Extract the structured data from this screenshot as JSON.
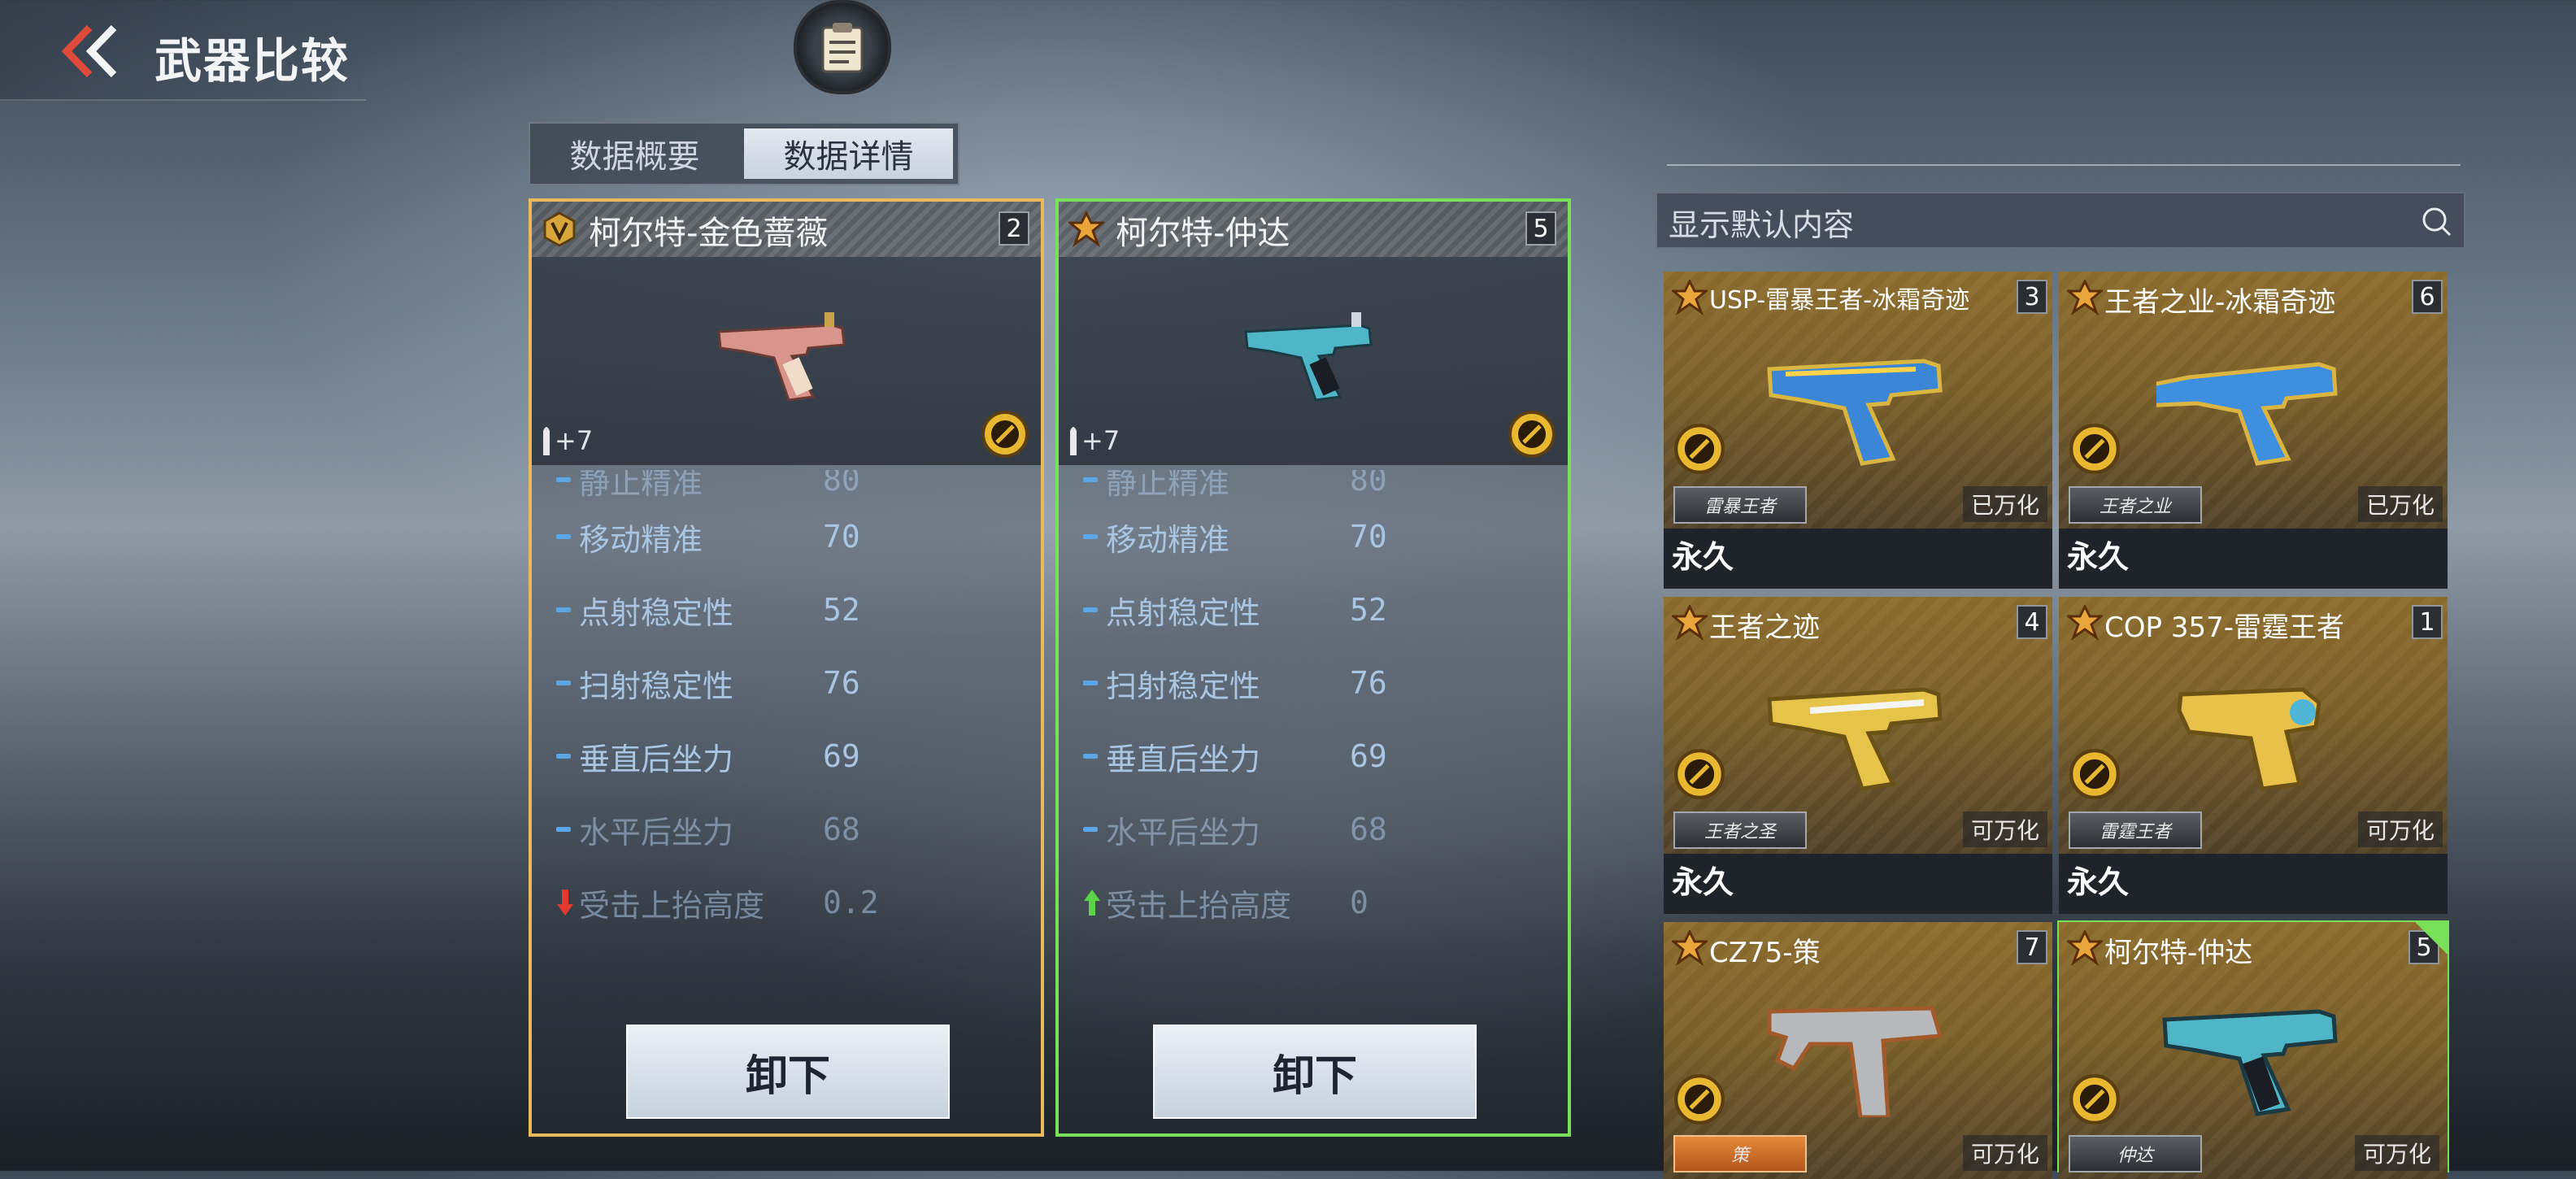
{
  "header": {
    "title": "武器比较",
    "back_icon": "back-chevron-icon",
    "notes_icon": "clipboard-icon"
  },
  "tabs": [
    {
      "label": "数据概要",
      "active": false
    },
    {
      "label": "数据详情",
      "active": true
    }
  ],
  "compare": [
    {
      "name": "柯尔特-金色蔷薇",
      "count": "2",
      "ammo": "+7",
      "border_color": "#e9b95a",
      "stats": [
        {
          "label": "静止精准",
          "value": "80",
          "trend": "neutral"
        },
        {
          "label": "移动精准",
          "value": "70",
          "trend": "neutral"
        },
        {
          "label": "点射稳定性",
          "value": "52",
          "trend": "neutral"
        },
        {
          "label": "扫射稳定性",
          "value": "76",
          "trend": "neutral"
        },
        {
          "label": "垂直后坐力",
          "value": "69",
          "trend": "neutral"
        },
        {
          "label": "水平后坐力",
          "value": "68",
          "trend": "neutral"
        },
        {
          "label": "受击上抬高度",
          "value": "0.2",
          "trend": "down"
        }
      ],
      "unload_label": "卸下"
    },
    {
      "name": "柯尔特-仲达",
      "count": "5",
      "ammo": "+7",
      "border_color": "#79e05a",
      "stats": [
        {
          "label": "静止精准",
          "value": "80",
          "trend": "neutral"
        },
        {
          "label": "移动精准",
          "value": "70",
          "trend": "neutral"
        },
        {
          "label": "点射稳定性",
          "value": "52",
          "trend": "neutral"
        },
        {
          "label": "扫射稳定性",
          "value": "76",
          "trend": "neutral"
        },
        {
          "label": "垂直后坐力",
          "value": "69",
          "trend": "neutral"
        },
        {
          "label": "水平后坐力",
          "value": "68",
          "trend": "neutral"
        },
        {
          "label": "受击上抬高度",
          "value": "0",
          "trend": "up"
        }
      ],
      "unload_label": "卸下"
    }
  ],
  "list": {
    "search_placeholder": "显示默认内容",
    "items": [
      {
        "name": "USP-雷暴王者-冰霜奇迹",
        "count": "3",
        "emblem": "雷暴王者",
        "status": "已万化",
        "duration": "永久",
        "selected": false
      },
      {
        "name": "王者之业-冰霜奇迹",
        "count": "6",
        "emblem": "王者之业",
        "status": "已万化",
        "duration": "永久",
        "selected": false
      },
      {
        "name": "王者之迹",
        "count": "4",
        "emblem": "王者之圣",
        "status": "可万化",
        "duration": "永久",
        "selected": false
      },
      {
        "name": "COP 357-雷霆王者",
        "count": "1",
        "emblem": "雷霆王者",
        "status": "可万化",
        "duration": "永久",
        "selected": false
      },
      {
        "name": "CZ75-策",
        "count": "7",
        "emblem": "策",
        "status": "可万化",
        "duration": "",
        "selected": false
      },
      {
        "name": "柯尔特-仲达",
        "count": "5",
        "emblem": "仲达",
        "status": "可万化",
        "duration": "",
        "selected": true
      }
    ]
  }
}
